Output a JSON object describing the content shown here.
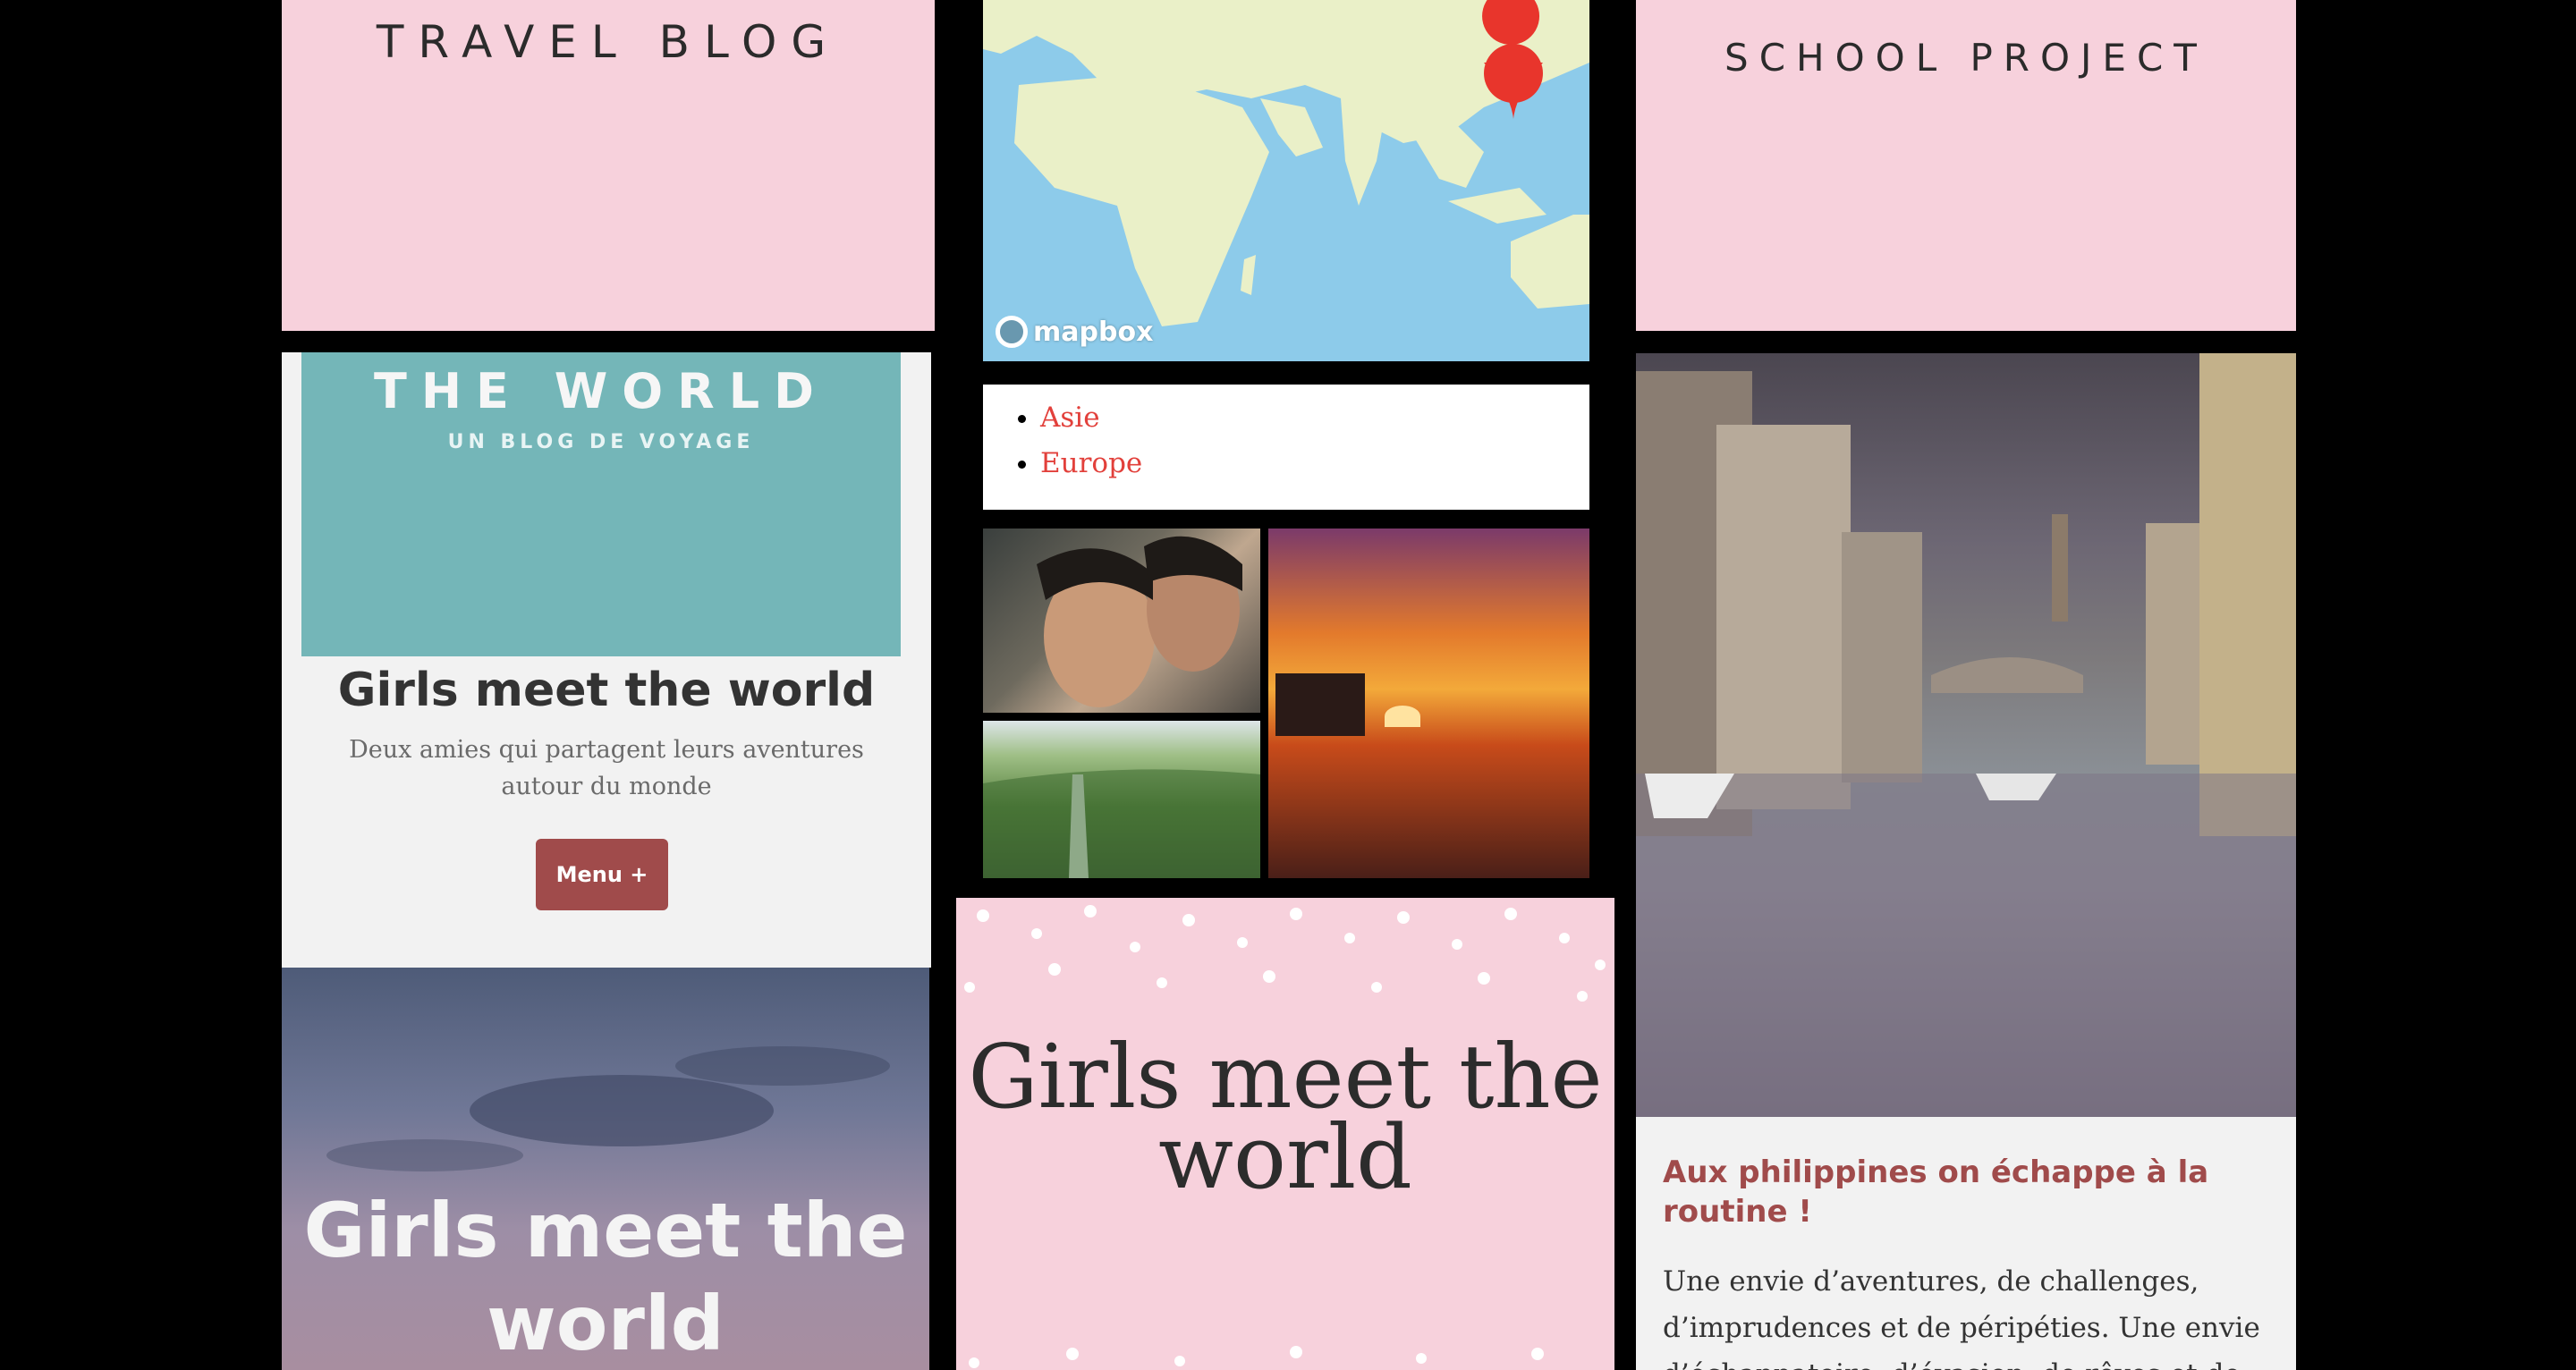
{
  "left_column": {
    "travel_blog_title": "TRAVEL BLOG",
    "card": {
      "hero_title": "THE WORLD",
      "hero_subtitle": "UN BLOG DE VOYAGE",
      "title": "Girls meet the world",
      "description": "Deux amies qui partagent leurs aventures autour du monde",
      "menu_label": "Menu +"
    },
    "sky_card_title": "Girls meet the world"
  },
  "middle_column": {
    "map": {
      "attribution": "mapbox",
      "marker_color": "#e8352c",
      "ocean_color": "#8dcbea",
      "land_color": "#eaf0c8"
    },
    "regions": [
      "Asie",
      "Europe"
    ],
    "dots_card_title": "Girls meet the world"
  },
  "right_column": {
    "school_project_title": "SCHOOL PROJECT",
    "post": {
      "title": "Aux philippines on échappe à la routine !",
      "excerpt": "Une envie d’aventures, de challenges, d’imprudences et de péripéties. Une envie d’échappatoire, d’évasion, de rêves et de..."
    }
  },
  "colors": {
    "pink_panel": "#f7d1dc",
    "teal_banner": "#74b6b8",
    "accent_red": "#a04b4b",
    "link_red": "#e2403b"
  }
}
